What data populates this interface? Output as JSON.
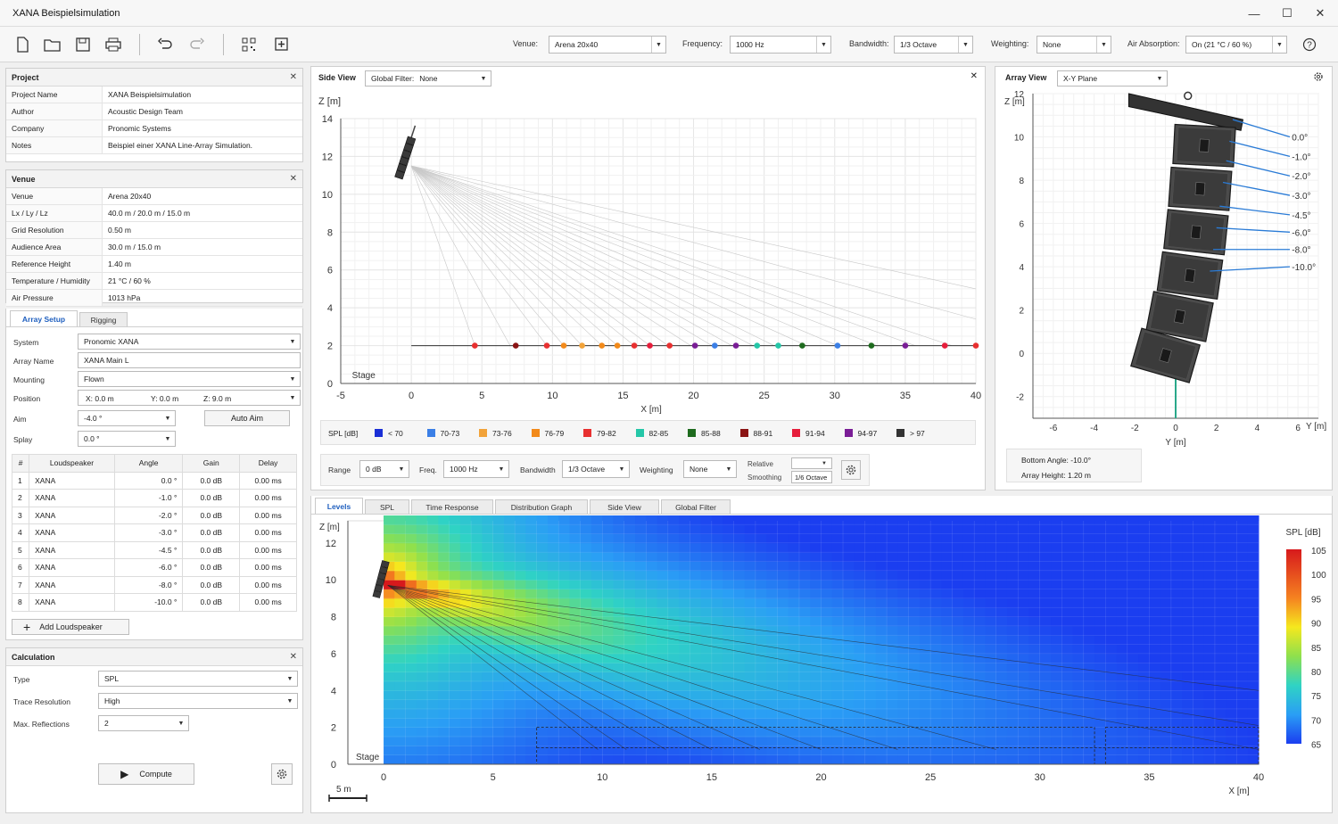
{
  "app": {
    "title": "XANA Beispielsimulation"
  },
  "toolbar": {
    "venue_label": "Venue:",
    "venue_value": "Arena 20x40",
    "frequency_label": "Frequency:",
    "frequency_value": "1000 Hz",
    "bandwidth_label": "Bandwidth:",
    "bandwidth_value": "1/3 Octave",
    "weighting_label": "Weighting:",
    "weighting_value": "None",
    "air_label": "Air Absorption:",
    "air_value": "On (21 °C / 60 %)"
  },
  "project": {
    "title": "Project",
    "rows": [
      {
        "k": "Project Name",
        "v": "XANA Beispielsimulation"
      },
      {
        "k": "Author",
        "v": "Acoustic Design Team"
      },
      {
        "k": "Company",
        "v": "Pronomic Systems"
      },
      {
        "k": "Notes",
        "v": "Beispiel einer XANA Line-Array Simulation."
      }
    ]
  },
  "venue": {
    "title": "Venue",
    "rows": [
      {
        "k": "Venue",
        "v": "Arena 20x40"
      },
      {
        "k": "Lx / Ly / Lz",
        "v": "40.0 m  /  20.0 m  /  15.0 m"
      },
      {
        "k": "Grid Resolution",
        "v": "0.50 m"
      },
      {
        "k": "Audience Area",
        "v": "30.0 m  /  15.0 m"
      },
      {
        "k": "Reference Height",
        "v": "1.40 m"
      },
      {
        "k": "Temperature / Humidity",
        "v": "21 °C / 60 %"
      },
      {
        "k": "Air Pressure",
        "v": "1013 hPa"
      }
    ]
  },
  "array": {
    "tab_setup": "Array Setup",
    "tab_rigging": "Rigging",
    "system_label": "System",
    "system_value": "Pronomic XANA",
    "name_label": "Array Name",
    "name_value": "XANA Main L",
    "mounting_label": "Mounting",
    "mounting_value": "Flown",
    "position_label": "Position",
    "pos_x": "X:  0.0 m",
    "pos_y": "Y:  0.0 m",
    "pos_z": "Z:  9.0 m",
    "aim_label": "Aim",
    "aim_value": "-4.0 °",
    "auto_aim": "Auto Aim",
    "splay_label": "Splay",
    "splay_value": "0.0 °",
    "headers": [
      "#",
      "Loudspeaker",
      "Angle",
      "Gain",
      "Delay"
    ],
    "rows": [
      [
        "1",
        "XANA",
        "0.0 °",
        "0.0 dB",
        "0.00 ms"
      ],
      [
        "2",
        "XANA",
        "-1.0 °",
        "0.0 dB",
        "0.00 ms"
      ],
      [
        "3",
        "XANA",
        "-2.0 °",
        "0.0 dB",
        "0.00 ms"
      ],
      [
        "4",
        "XANA",
        "-3.0 °",
        "0.0 dB",
        "0.00 ms"
      ],
      [
        "5",
        "XANA",
        "-4.5 °",
        "0.0 dB",
        "0.00 ms"
      ],
      [
        "6",
        "XANA",
        "-6.0 °",
        "0.0 dB",
        "0.00 ms"
      ],
      [
        "7",
        "XANA",
        "-8.0 °",
        "0.0 dB",
        "0.00 ms"
      ],
      [
        "8",
        "XANA",
        "-10.0 °",
        "0.0 dB",
        "0.00 ms"
      ]
    ],
    "add_label": "Add Loudspeaker"
  },
  "calc": {
    "title": "Calculation",
    "type_label": "Type",
    "type_value": "SPL",
    "trace_label": "Trace Resolution",
    "trace_value": "High",
    "refl_label": "Max. Reflections",
    "refl_value": "2",
    "compute_label": "Compute"
  },
  "side_view": {
    "title": "Side View",
    "filter_label": "Global Filter:",
    "filter_value": "None",
    "zlabel": "Z [m]",
    "xlabel": "X [m]",
    "stage": "Stage",
    "yticks": [
      "14",
      "12",
      "10",
      "8",
      "6",
      "4",
      "2",
      "0"
    ],
    "xticks": [
      "-5",
      "0",
      "5",
      "10",
      "15",
      "20",
      "25",
      "30",
      "35",
      "40"
    ],
    "legend_title": "SPL [dB]",
    "legend": [
      {
        "label": "< 70",
        "color": "#1a2fd6"
      },
      {
        "label": "70-73",
        "color": "#3b7fe6"
      },
      {
        "label": "73-76",
        "color": "#f2a33a"
      },
      {
        "label": "76-79",
        "color": "#f28a1a"
      },
      {
        "label": "79-82",
        "color": "#e83030"
      },
      {
        "label": "82-85",
        "color": "#25c7a8"
      },
      {
        "label": "85-88",
        "color": "#1e6b1e"
      },
      {
        "label": "88-91",
        "color": "#8b1414"
      },
      {
        "label": "91-94",
        "color": "#e61e3c"
      },
      {
        "label": "94-97",
        "color": "#7a1d96"
      },
      {
        "label": "> 97",
        "color": "#333333"
      }
    ],
    "range_label": "Range",
    "range_value": "0 dB",
    "freq_label": "Freq.",
    "freq_value": "1000 Hz",
    "bw_label": "Bandwidth",
    "bw_value": "1/3 Octave",
    "weight_label": "Weighting",
    "weight_value": "None",
    "rel_label": "Relative",
    "smooth_label": "Smoothing",
    "smooth_value": "1/6 Octave"
  },
  "array_view": {
    "title": "Array View",
    "plane": "X-Y Plane",
    "zlabel": "Z [m]",
    "ylabel": "Y [m]",
    "yticks": [
      "12",
      "10",
      "8",
      "6",
      "4",
      "2",
      "0",
      "-2"
    ],
    "xticks": [
      "-6",
      "-4",
      "-2",
      "0",
      "2",
      "4",
      "6"
    ],
    "angles": [
      "0.0°",
      "-1.0°",
      "-2.0°",
      "-3.0°",
      "-4.5°",
      "-6.0°",
      "-8.0°",
      "-10.0°"
    ],
    "bottom_angle": "Bottom Angle:  -10.0°",
    "array_height": "Array Height:  1.20 m"
  },
  "levels": {
    "tabs": [
      "Levels",
      "SPL",
      "Time Response",
      "Distribution Graph",
      "Side View",
      "Global Filter"
    ],
    "zlabel": "Z [m]",
    "xlabel": "X [m]",
    "stage": "Stage",
    "scale": "5 m",
    "yticks": [
      "12",
      "10",
      "8",
      "6",
      "4",
      "2",
      "0"
    ],
    "xticks": [
      "0",
      "5",
      "10",
      "15",
      "20",
      "25",
      "30",
      "35",
      "40"
    ],
    "cbar_title": "SPL [dB]",
    "cbar_ticks": [
      "105",
      "100",
      "95",
      "90",
      "85",
      "80",
      "75",
      "70",
      "65"
    ]
  }
}
